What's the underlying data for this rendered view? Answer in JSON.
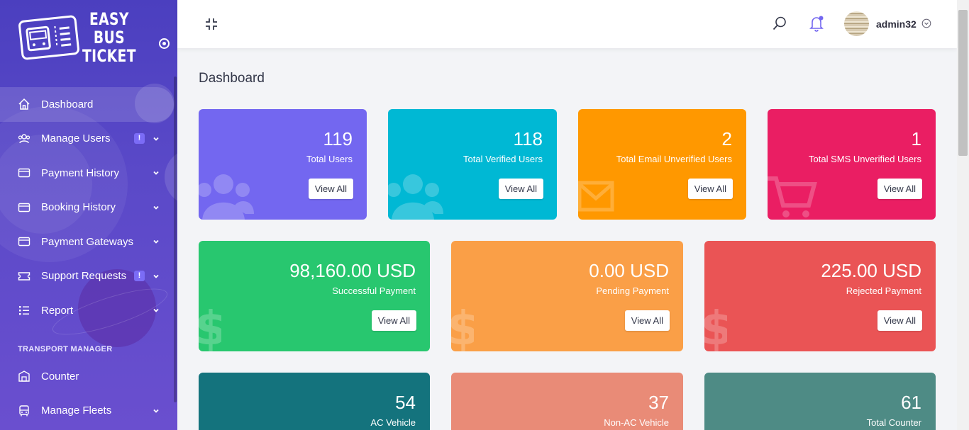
{
  "brand": {
    "line1": "EASY BUS",
    "line2": "TICKET"
  },
  "sidebar": {
    "items": [
      {
        "label": "Dashboard",
        "icon": "home-icon",
        "active": true
      },
      {
        "label": "Manage Users",
        "icon": "users-icon",
        "badge": "!",
        "has_arrow": true
      },
      {
        "label": "Payment History",
        "icon": "credit-card-icon",
        "has_arrow": true
      },
      {
        "label": "Booking History",
        "icon": "credit-card-icon",
        "has_arrow": true
      },
      {
        "label": "Payment Gateways",
        "icon": "credit-card-icon",
        "has_arrow": true
      },
      {
        "label": "Support Requests",
        "icon": "ticket-icon",
        "badge": "!",
        "has_arrow": true
      },
      {
        "label": "Report",
        "icon": "list-icon",
        "has_arrow": true
      }
    ],
    "section_title": "TRANSPORT MANAGER",
    "items2": [
      {
        "label": "Counter",
        "icon": "building-icon"
      },
      {
        "label": "Manage Fleets",
        "icon": "bus-icon",
        "has_arrow": true
      }
    ]
  },
  "topbar": {
    "username": "admin32"
  },
  "page": {
    "title": "Dashboard"
  },
  "cards_row1": [
    {
      "value": "119",
      "label": "Total Users",
      "button": "View All",
      "color": "#7367f0",
      "icon": "users-icon"
    },
    {
      "value": "118",
      "label": "Total Verified Users",
      "button": "View All",
      "color": "#00b8d4",
      "icon": "users-icon"
    },
    {
      "value": "2",
      "label": "Total Email Unverified Users",
      "button": "View All",
      "color": "#ff9800",
      "icon": "envelope-icon"
    },
    {
      "value": "1",
      "label": "Total SMS Unverified Users",
      "button": "View All",
      "color": "#ea1e63",
      "icon": "cart-icon"
    }
  ],
  "cards_row2": [
    {
      "value": "98,160.00 USD",
      "label": "Successful Payment",
      "button": "View All",
      "color": "#28c76f",
      "icon": "dollar-icon"
    },
    {
      "value": "0.00 USD",
      "label": "Pending Payment",
      "button": "View All",
      "color": "#fa9f47",
      "icon": "dollar-icon"
    },
    {
      "value": "225.00 USD",
      "label": "Rejected Payment",
      "button": "View All",
      "color": "#ea5455",
      "icon": "dollar-icon"
    }
  ],
  "cards_row3": [
    {
      "value": "54",
      "label": "AC Vehicle",
      "color": "#14737d"
    },
    {
      "value": "37",
      "label": "Non-AC Vehicle",
      "color": "#e98b77"
    },
    {
      "value": "61",
      "label": "Total Counter",
      "color": "#4e8b85"
    }
  ]
}
